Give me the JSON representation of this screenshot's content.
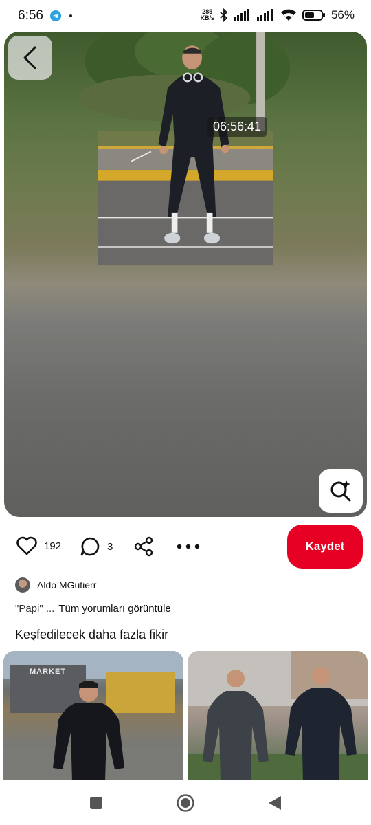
{
  "status_bar": {
    "time": "6:56",
    "net_speed_value": "285",
    "net_speed_unit": "KB/s",
    "battery": "56%"
  },
  "pin": {
    "timestamp": "06:56:41",
    "likes": "192",
    "comments": "3",
    "save_label": "Kaydet",
    "author": "Aldo MGutierr",
    "comment_preview": "\"Papi\" ...",
    "view_all_comments": "Tüm yorumları görüntüle"
  },
  "more_ideas": {
    "title": "Keşfedilecek daha fazla fikir",
    "left_sign": "MARKET"
  },
  "colors": {
    "accent": "#e60023",
    "telegram": "#2aa3e0"
  },
  "icons": [
    "telegram-icon",
    "bluetooth-icon",
    "signal-icon",
    "wifi-icon",
    "battery-icon",
    "back-icon",
    "visual-search-icon",
    "heart-icon",
    "comment-icon",
    "share-icon",
    "more-icon",
    "stop-icon",
    "home-icon",
    "back-triangle-icon"
  ]
}
